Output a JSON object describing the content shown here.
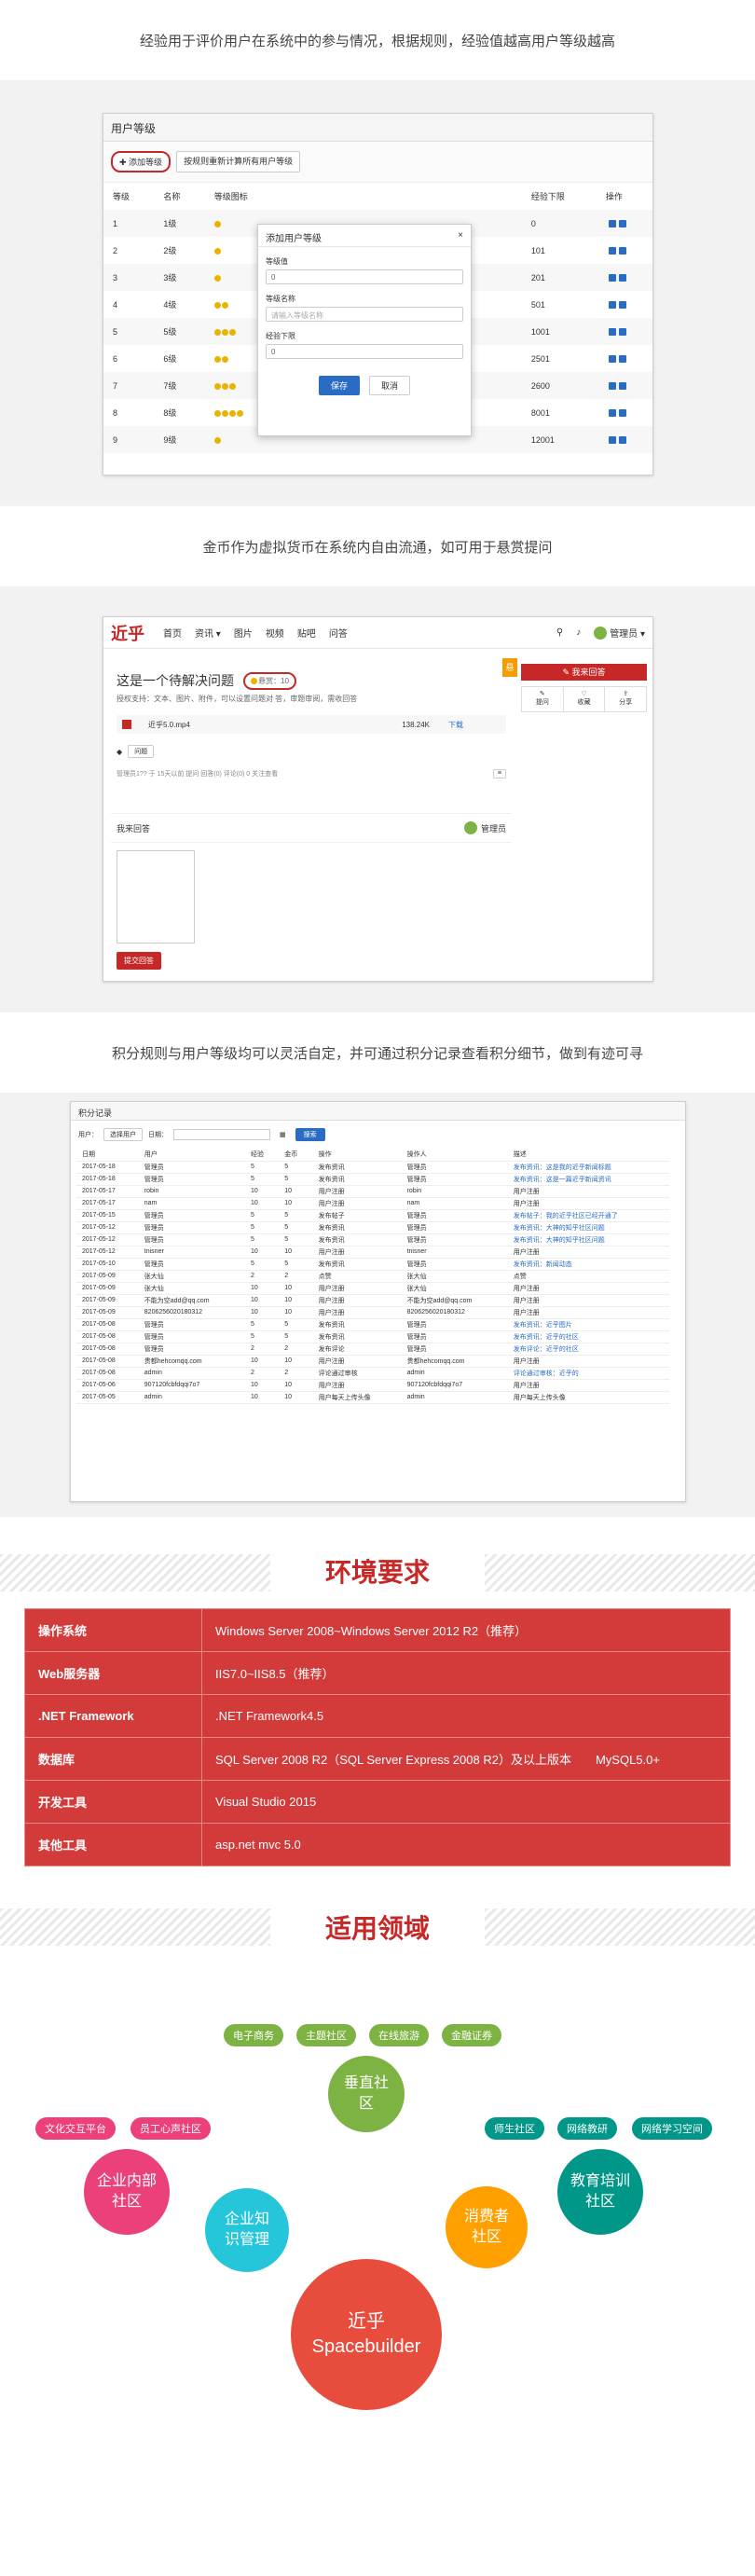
{
  "sections": {
    "exp_caption": "经验用于评价用户在系统中的参与情况，根据规则，经验值越高用户等级越高",
    "coin_caption": "金币作为虚拟货币在系统内自由流通，如可用于悬赏提问",
    "points_caption": "积分规则与用户等级均可以灵活自定，并可通过积分记录查看积分细节，做到有迹可寻"
  },
  "levels_panel": {
    "title": "用户等级",
    "add_button": "添加等级",
    "recalc_button": "按规则重新计算所有用户等级",
    "columns": [
      "等级",
      "名称",
      "等级图标",
      "经验下限",
      "操作"
    ],
    "rows": [
      {
        "level": "1",
        "name": "1级",
        "icons": 1,
        "min_exp": "0"
      },
      {
        "level": "2",
        "name": "2级",
        "icons": 1,
        "min_exp": "101"
      },
      {
        "level": "3",
        "name": "3级",
        "icons": 1,
        "min_exp": "201"
      },
      {
        "level": "4",
        "name": "4级",
        "icons": 2,
        "min_exp": "501"
      },
      {
        "level": "5",
        "name": "5级",
        "icons": 3,
        "min_exp": "1001"
      },
      {
        "level": "6",
        "name": "6级",
        "icons": 2,
        "min_exp": "2501"
      },
      {
        "level": "7",
        "name": "7级",
        "icons": 3,
        "min_exp": "2600"
      },
      {
        "level": "8",
        "name": "8级",
        "icons": 4,
        "min_exp": "8001"
      },
      {
        "level": "9",
        "name": "9级",
        "icons": 1,
        "min_exp": "12001"
      }
    ],
    "modal": {
      "title": "添加用户等级",
      "close": "×",
      "field1_label": "等级值",
      "field1_value": "0",
      "field2_label": "等级名称",
      "field2_placeholder": "请输入等级名称",
      "field3_label": "经验下限",
      "field3_value": "0",
      "save": "保存",
      "cancel": "取消"
    }
  },
  "qa_panel": {
    "logo": "近乎",
    "nav": [
      "首页",
      "资讯 ▾",
      "图片",
      "视频",
      "贴吧",
      "问答"
    ],
    "user": "管理员 ▾",
    "question_title": "这是一个待解决问题",
    "reward": "悬赏：10",
    "description": "授权支持：文本、图片、附件，可以设置问题对 答，审题审阅，需收回答",
    "attachment_name": "近乎5.0.mp4",
    "attachment_size": "138.24K",
    "download": "下载",
    "tag": "问题",
    "meta": "管理员1?? 于 15天以前 提问 回答(0) 评论(0) 0 关注查看",
    "answer_button": "我来回答",
    "actions": [
      "提问",
      "收藏",
      "分享"
    ],
    "badge": "悬",
    "answer_section_title": "我来回答",
    "answer_user": "管理员",
    "submit_answer": "提交回答"
  },
  "points_panel": {
    "title": "积分记录",
    "filter_user_label": "用户：",
    "filter_user_button": "选择用户",
    "filter_date_label": "日期：",
    "search_button": "搜索",
    "columns": [
      "日期",
      "用户",
      "经验",
      "金币",
      "操作",
      "操作人",
      "描述"
    ],
    "rows": [
      [
        "2017-05-18",
        "管理员",
        "5",
        "5",
        "发布资讯",
        "管理员",
        "发布资讯：这是我的近乎新闻标题"
      ],
      [
        "2017-05-18",
        "管理员",
        "5",
        "5",
        "发布资讯",
        "管理员",
        "发布资讯：这是一篇近乎新闻资讯"
      ],
      [
        "2017-05-17",
        "robin",
        "10",
        "10",
        "用户注册",
        "robin",
        "用户注册"
      ],
      [
        "2017-05-17",
        "nam",
        "10",
        "10",
        "用户注册",
        "nam",
        "用户注册"
      ],
      [
        "2017-05-15",
        "管理员",
        "5",
        "5",
        "发布帖子",
        "管理员",
        "发布帖子：我的近乎社区已经开通了"
      ],
      [
        "2017-05-12",
        "管理员",
        "5",
        "5",
        "发布资讯",
        "管理员",
        "发布资讯：大神的知乎社区问题"
      ],
      [
        "2017-05-12",
        "管理员",
        "5",
        "5",
        "发布资讯",
        "管理员",
        "发布资讯：大神的知乎社区问题"
      ],
      [
        "2017-05-12",
        "tnisner",
        "10",
        "10",
        "用户注册",
        "tnisner",
        "用户注册"
      ],
      [
        "2017-05-10",
        "管理员",
        "5",
        "5",
        "发布资讯",
        "管理员",
        "发布资讯：新闻动态"
      ],
      [
        "2017-05-09",
        "张大仙",
        "2",
        "2",
        "点赞",
        "张大仙",
        "点赞"
      ],
      [
        "2017-05-09",
        "张大仙",
        "10",
        "10",
        "用户注册",
        "张大仙",
        "用户注册"
      ],
      [
        "2017-05-09",
        "不能为空add@qq.com",
        "10",
        "10",
        "用户注册",
        "不能为空add@qq.com",
        "用户注册"
      ],
      [
        "2017-05-09",
        "8206256020180312",
        "10",
        "10",
        "用户注册",
        "8206256020180312",
        "用户注册"
      ],
      [
        "2017-05-08",
        "管理员",
        "5",
        "5",
        "发布资讯",
        "管理员",
        "发布资讯：近乎图片"
      ],
      [
        "2017-05-08",
        "管理员",
        "5",
        "5",
        "发布资讯",
        "管理员",
        "发布资讯：近乎的社区"
      ],
      [
        "2017-05-08",
        "管理员",
        "2",
        "2",
        "发布评论",
        "管理员",
        "发布评论：近乎的社区"
      ],
      [
        "2017-05-08",
        "贵都hehcomqq.com",
        "10",
        "10",
        "用户注册",
        "贵都hehcomqq.com",
        "用户注册"
      ],
      [
        "2017-05-08",
        "admin",
        "2",
        "2",
        "评论通过审核",
        "admin",
        "评论通过审核：近乎的"
      ],
      [
        "2017-05-06",
        "907120fcbfdqqi7o7",
        "10",
        "10",
        "用户注册",
        "907120fcbfdqqi7o7",
        "用户注册"
      ],
      [
        "2017-05-05",
        "admin",
        "10",
        "10",
        "用户每天上传头像",
        "admin",
        "用户每天上传头像"
      ]
    ]
  },
  "env_section": {
    "title": "环境要求",
    "rows": [
      {
        "key": "操作系统",
        "value": "Windows Server 2008~Windows Server 2012 R2（推荐）"
      },
      {
        "key": "Web服务器",
        "value": "IIS7.0~IIS8.5（推荐）"
      },
      {
        "key": ".NET Framework",
        "value": ".NET Framework4.5"
      },
      {
        "key": "数据库",
        "value": "SQL Server 2008 R2（SQL Server Express 2008 R2）及以上版本　　MySQL5.0+"
      },
      {
        "key": "开发工具",
        "value": "Visual Studio 2015"
      },
      {
        "key": "其他工具",
        "value": "asp.net mvc 5.0"
      }
    ]
  },
  "domain_section": {
    "title": "适用领域",
    "pills": [
      "电子商务",
      "主题社区",
      "在线旅游",
      "金融证券",
      "文化交互平台",
      "员工心声社区",
      "师生社区",
      "网络教研",
      "网络学习空间"
    ],
    "circles": [
      "垂直社区",
      "企业内部社区",
      "企业知识管理",
      "消费者社区",
      "教育培训社区"
    ],
    "center_line1": "近乎",
    "center_line2": "Spacebuilder"
  },
  "colors": {
    "red": "#d33b3b",
    "green": "#7cb342",
    "pink": "#ec407a",
    "cyan": "#26c6da",
    "orange": "#ffa000",
    "teal": "#009688",
    "blue": "#2a6cc4"
  }
}
